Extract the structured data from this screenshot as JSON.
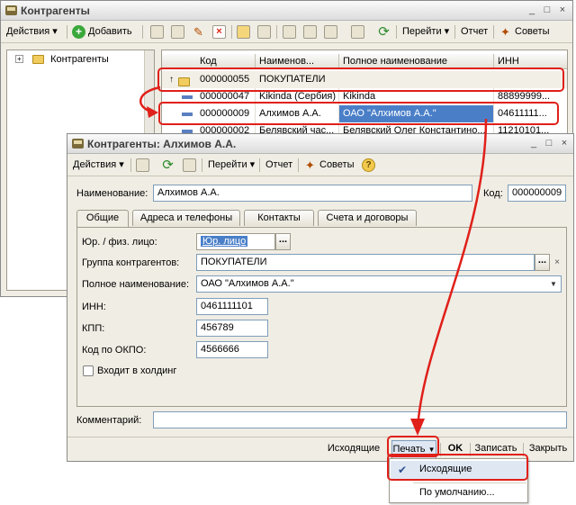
{
  "main_window": {
    "title": "Контрагенты",
    "toolbar": {
      "actions_label": "Действия",
      "add_label": "Добавить",
      "goto_label": "Перейти",
      "report_label": "Отчет",
      "tips_label": "Советы"
    },
    "tree": {
      "root_label": "Контрагенты"
    },
    "table": {
      "columns": [
        "Код",
        "Наименов...",
        "Полное наименование",
        "ИНН"
      ],
      "rows": [
        {
          "code": "000000055",
          "name": "ПОКУПАТЕЛИ",
          "full_name": "",
          "inn": ""
        },
        {
          "code": "000000047",
          "name": "Kikinda (Сербия)",
          "full_name": "Kikinda",
          "inn": "88899999..."
        },
        {
          "code": "000000009",
          "name": "Алхимов А.А.",
          "full_name": "ОАО \"Алхимов А.А.\"",
          "inn": "04611111..."
        },
        {
          "code": "000000002",
          "name": "Белявский час...",
          "full_name": "Белявский Олег Константино...",
          "inn": "11210101..."
        }
      ]
    }
  },
  "dialog": {
    "title": "Контрагенты: Алхимов А.А.",
    "toolbar": {
      "actions_label": "Действия",
      "goto_label": "Перейти",
      "report_label": "Отчет",
      "tips_label": "Советы"
    },
    "name_label": "Наименование:",
    "name_value": "Алхимов А.А.",
    "code_label": "Код:",
    "code_value": "000000009",
    "tabs": [
      "Общие",
      "Адреса и телефоны",
      "Контакты",
      "Счета и договоры"
    ],
    "fields": {
      "legal_type_label": "Юр. / физ. лицо:",
      "legal_type_value": "Юр. лицо",
      "group_label": "Группа контрагентов:",
      "group_value": "ПОКУПАТЕЛИ",
      "full_name_label": "Полное наименование:",
      "full_name_value": "ОАО \"Алхимов А.А.\"",
      "inn_label": "ИНН:",
      "inn_value": "0461111101",
      "kpp_label": "КПП:",
      "kpp_value": "456789",
      "okpo_label": "Код по ОКПО:",
      "okpo_value": "4566666",
      "holding_label": "Входит в холдинг"
    },
    "comment_label": "Комментарий:",
    "comment_value": "",
    "bottom": {
      "outgoing_label": "Исходящие",
      "print_label": "Печать",
      "ok_label": "OK",
      "save_label": "Записать",
      "close_label": "Закрыть"
    }
  },
  "print_menu": {
    "items": [
      "Исходящие",
      "По умолчанию..."
    ]
  },
  "colors": {
    "annotation_red": "#e0201a",
    "selection_blue": "#4a7fc8",
    "window_bg": "#f0ede4"
  }
}
